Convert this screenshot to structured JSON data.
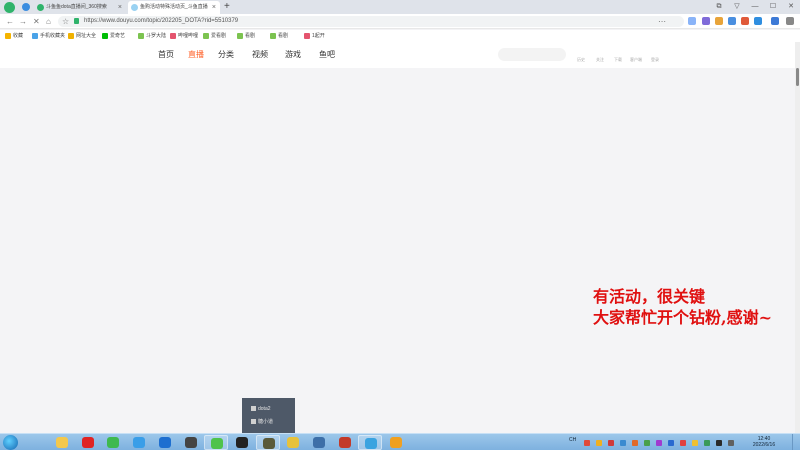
{
  "browser": {
    "tabs": [
      {
        "title": "斗鱼鱼dota直播间_360搜索",
        "favicon_color": "#2fb36b",
        "close": "×",
        "active": false
      },
      {
        "title": "鱼购活动特殊活动页_斗鱼直播",
        "favicon_color": "#9ad2f2",
        "close": "×",
        "active": true
      }
    ],
    "new_tab": "+",
    "window_controls": [
      "⧉",
      "▽",
      "—",
      "☐",
      "✕"
    ],
    "nav": {
      "back": "←",
      "forward": "→",
      "reload": "✕",
      "home": "⌂",
      "fav": "☆"
    },
    "url": "https://www.douyu.com/topic/202205_DOTA?rid=5510379",
    "toolbar_more": "⋯",
    "toolbar_colors": [
      "#8ab4f8",
      "#7f6bd9",
      "#e8a43a",
      "#4a8fe0",
      "#e05a3a",
      "#2f8ee0",
      "#3d7ad6",
      "#888888"
    ]
  },
  "bookmarks": [
    {
      "label": "收藏",
      "color": "#f5b400"
    },
    {
      "label": "手机收藏夹",
      "color": "#4aa3e8"
    },
    {
      "label": "网址大全",
      "color": "#f0b100"
    },
    {
      "label": "爱奇艺",
      "color": "#00be06"
    },
    {
      "label": "斗罗大陆",
      "color": "#7cc350"
    },
    {
      "label": "哔哩哔哩",
      "color": "#e4546e"
    },
    {
      "label": "爱看剧",
      "color": "#7cc350"
    },
    {
      "label": "看剧",
      "color": "#7cc350"
    },
    {
      "label": "看剧",
      "color": "#7cc350"
    },
    {
      "label": "1起开",
      "color": "#e4546e"
    }
  ],
  "site": {
    "nav": [
      {
        "label": "首页",
        "active": false
      },
      {
        "label": "直播",
        "active": true
      },
      {
        "label": "分类",
        "active": false
      },
      {
        "label": "视频",
        "active": false
      },
      {
        "label": "游戏",
        "active": false
      },
      {
        "label": "鱼吧",
        "active": false
      }
    ],
    "right_links": [
      "历史",
      "关注",
      "下载",
      "客户端",
      "登录"
    ]
  },
  "overlay_text": {
    "line1": "有活动，很关键",
    "line2": "大家帮忙开个钻粉,感谢~"
  },
  "popup_menu": [
    "dota2",
    "糖小道"
  ],
  "taskbar": {
    "apps": [
      {
        "name": "explorer",
        "color": "#f3c84c",
        "open": false
      },
      {
        "name": "netease-music",
        "color": "#e02424",
        "open": false
      },
      {
        "name": "media",
        "color": "#3fb94f",
        "open": false
      },
      {
        "name": "browser-360",
        "color": "#3a9ee8",
        "open": false
      },
      {
        "name": "app-blue",
        "color": "#1e6fd0",
        "open": false
      },
      {
        "name": "user",
        "color": "#444444",
        "open": false
      },
      {
        "name": "browser-green",
        "color": "#4fc34a",
        "open": true
      },
      {
        "name": "obs",
        "color": "#222222",
        "open": false
      },
      {
        "name": "dota",
        "color": "#5a5a3a",
        "open": true
      },
      {
        "name": "game-yellow",
        "color": "#e6c23c",
        "open": false
      },
      {
        "name": "app-steel",
        "color": "#3d6fa8",
        "open": false
      },
      {
        "name": "game-red",
        "color": "#c23a2a",
        "open": false
      },
      {
        "name": "ie",
        "color": "#3aa3e0",
        "open": true
      },
      {
        "name": "app-orange",
        "color": "#f0a020",
        "open": false
      }
    ],
    "tray_label": "CH",
    "tray_colors": [
      "#e04a3a",
      "#f0b020",
      "#d03a3a",
      "#3a8ad0",
      "#e06a2a",
      "#4aa04a",
      "#a03ad0",
      "#2a6ad0",
      "#e04040",
      "#f0c030",
      "#3a9a5a",
      "#2a2a2a",
      "#606060"
    ],
    "clock_time": "12:40",
    "clock_date": "2022/6/16"
  }
}
